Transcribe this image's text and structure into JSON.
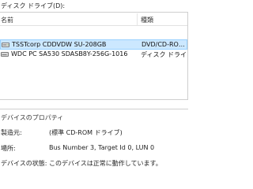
{
  "section_label": "ディスク ドライブ(D):",
  "list": {
    "columns": {
      "name": "名前",
      "type": "種類"
    },
    "rows": [
      {
        "name": "TSSTcorp CDDVDW SU-208GB",
        "type": "DVD/CD-RO…",
        "icon": "optical-drive-icon",
        "selected": true
      },
      {
        "name": "WDC PC SA530 SDASB8Y-256G-1016",
        "type": "ディスク ドライブ",
        "icon": "disk-drive-icon",
        "selected": false
      }
    ]
  },
  "properties": {
    "title": "デバイスのプロパティ",
    "items": [
      {
        "label": "製造元:",
        "value": "(標準 CD-ROM ドライブ)"
      },
      {
        "label": "場所:",
        "value": "Bus Number 3, Target Id 0, LUN 0"
      },
      {
        "label": "デバイスの状態:",
        "value": "このデバイスは正常に動作しています。"
      }
    ]
  },
  "colors": {
    "selection_bg": "#cce8ff",
    "selection_border": "#99d1ff"
  }
}
